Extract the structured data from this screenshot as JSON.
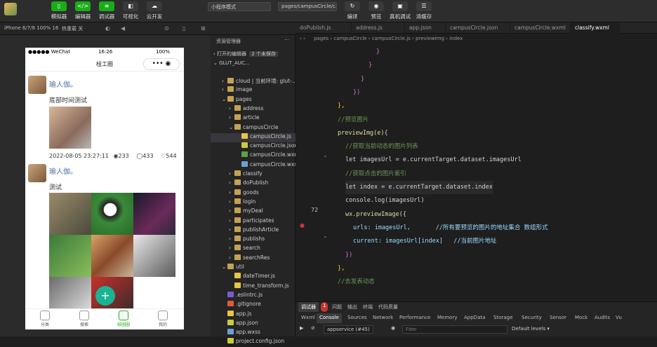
{
  "toolbar": {
    "buttons": [
      {
        "label": "模拟器",
        "icon": "phone-icon"
      },
      {
        "label": "编辑器",
        "icon": "code-icon"
      },
      {
        "label": "调试器",
        "icon": "debug-icon"
      },
      {
        "label": "可视化",
        "icon": "visual-icon"
      },
      {
        "label": "云开发",
        "icon": "cloud-icon"
      }
    ],
    "mode_select": "小程序模式",
    "page_select": "pages/campusCircle/c...",
    "right_buttons": [
      {
        "label": "编译"
      },
      {
        "label": "预览"
      },
      {
        "label": "真机调试"
      },
      {
        "label": "清缓存"
      }
    ]
  },
  "subbar": {
    "device": "iPhone 6/7/8 100% 16",
    "hotreload": "热重载 关"
  },
  "phone": {
    "status_carrier": "●●●●● WeChat",
    "status_time": "16:26",
    "status_battery": "100%",
    "nav_title": "桂工圈",
    "capsule": "•••  ◉",
    "posts": [
      {
        "user": "瑜人伽。",
        "text": "底部时间测试",
        "datetime": "2022-08-05 23:27:11",
        "views": "233",
        "comments": "433",
        "likes": "544"
      },
      {
        "user": "瑜人伽。",
        "text": "测试"
      }
    ],
    "fab": "+",
    "tabs": [
      {
        "label": "分类"
      },
      {
        "label": "搜索"
      },
      {
        "label": "校园圈"
      },
      {
        "label": "我的"
      }
    ]
  },
  "explorer": {
    "title": "资源管理器",
    "open_editors": "打开的编辑器",
    "unsaved": "2 个未保存",
    "project": "GLUT_AUC...",
    "items": [
      {
        "label": "cloud | 当前环境: glut-...",
        "depth": 1,
        "kind": "folder"
      },
      {
        "label": "image",
        "depth": 1,
        "kind": "folder"
      },
      {
        "label": "pages",
        "depth": 1,
        "kind": "folder-open"
      },
      {
        "label": "address",
        "depth": 2,
        "kind": "folder"
      },
      {
        "label": "article",
        "depth": 2,
        "kind": "folder"
      },
      {
        "label": "campusCircle",
        "depth": 2,
        "kind": "folder-open"
      },
      {
        "label": "campusCircle.js",
        "depth": 3,
        "kind": "js",
        "selected": true
      },
      {
        "label": "campusCircle.json",
        "depth": 3,
        "kind": "json"
      },
      {
        "label": "campusCircle.wxml",
        "depth": 3,
        "kind": "wxml"
      },
      {
        "label": "campusCircle.wxss",
        "depth": 3,
        "kind": "wxss"
      },
      {
        "label": "classify",
        "depth": 2,
        "kind": "folder"
      },
      {
        "label": "doPublish",
        "depth": 2,
        "kind": "folder"
      },
      {
        "label": "goods",
        "depth": 2,
        "kind": "folder"
      },
      {
        "label": "login",
        "depth": 2,
        "kind": "folder"
      },
      {
        "label": "myDeal",
        "depth": 2,
        "kind": "folder"
      },
      {
        "label": "participates",
        "depth": 2,
        "kind": "folder"
      },
      {
        "label": "publishArticle",
        "depth": 2,
        "kind": "folder"
      },
      {
        "label": "publishs",
        "depth": 2,
        "kind": "folder"
      },
      {
        "label": "search",
        "depth": 2,
        "kind": "folder"
      },
      {
        "label": "searchRes",
        "depth": 2,
        "kind": "folder"
      },
      {
        "label": "util",
        "depth": 1,
        "kind": "folder-open"
      },
      {
        "label": "dateTimer.js",
        "depth": 2,
        "kind": "js"
      },
      {
        "label": "time_transform.js",
        "depth": 2,
        "kind": "js"
      },
      {
        "label": ".eslintrc.js",
        "depth": 1,
        "kind": "eslint"
      },
      {
        "label": ".gitignore",
        "depth": 1,
        "kind": "git"
      },
      {
        "label": "app.js",
        "depth": 1,
        "kind": "js"
      },
      {
        "label": "app.json",
        "depth": 1,
        "kind": "json"
      },
      {
        "label": "app.wxss",
        "depth": 1,
        "kind": "wxss"
      },
      {
        "label": "project.config.json",
        "depth": 1,
        "kind": "json"
      }
    ]
  },
  "editor": {
    "tabs": [
      "doPublish.js",
      "address.js",
      "app.json",
      "campusCircle.json",
      "campusCircle.wxml",
      "classify.wxml"
    ],
    "breadcrumb": "pages › campusCircle › campusCircle.js › previewImg › index",
    "current_line": "72",
    "lines": [
      {
        "indent": 10,
        "text": "}",
        "cls": "br"
      },
      {
        "indent": 8,
        "text": "}",
        "cls": "br"
      },
      {
        "indent": 6,
        "text": "}",
        "cls": "br"
      },
      {
        "indent": 4,
        "text": "})",
        "cls": "br"
      },
      {
        "indent": 0,
        "text": "},",
        "cls": "yl"
      },
      {
        "indent": 0,
        "text": "//预览图片",
        "cls": "cm"
      },
      {
        "indent": 0,
        "text": "previewImg(e){",
        "cls": "fn"
      },
      {
        "indent": 2,
        "text": "//获取当前动态的图片列表",
        "cls": "cm"
      },
      {
        "indent": 2,
        "text": "let imagesUrl = e.currentTarget.dataset.imagesUrl",
        "cls": "tx"
      },
      {
        "indent": 2,
        "text": "//获取点击的图片索引",
        "cls": "cm"
      },
      {
        "indent": 2,
        "text": "let index = e.currentTarget.dataset.index",
        "cls": "tx"
      },
      {
        "indent": 2,
        "text": "console.log(imagesUrl)",
        "cls": "tx"
      },
      {
        "indent": 2,
        "text": "wx.previewImage({",
        "cls": "fn"
      },
      {
        "indent": 4,
        "text": "urls: imagesUrl,       //所有要预览的图片的地址集合 数组形式",
        "cls": "pr"
      },
      {
        "indent": 4,
        "text": "current: imagesUrl[index]   //当前图片地址",
        "cls": "pr"
      },
      {
        "indent": 2,
        "text": "})",
        "cls": "br"
      },
      {
        "indent": 0,
        "text": "},",
        "cls": "yl"
      },
      {
        "indent": 0,
        "text": "//去发表动态",
        "cls": "cm"
      }
    ]
  },
  "console": {
    "top_tabs": [
      "调试器",
      "1",
      "问题",
      "输出",
      "终端",
      "代码质量"
    ],
    "tabs": [
      "Wxml",
      "Console",
      "Sources",
      "Network",
      "Performance",
      "Memory",
      "AppData",
      "Storage",
      "Security",
      "Sensor",
      "Mock",
      "Audits",
      "Vu"
    ],
    "context": "appservice (#45)",
    "filter_placeholder": "Filter",
    "levels": "Default levels ▾"
  }
}
